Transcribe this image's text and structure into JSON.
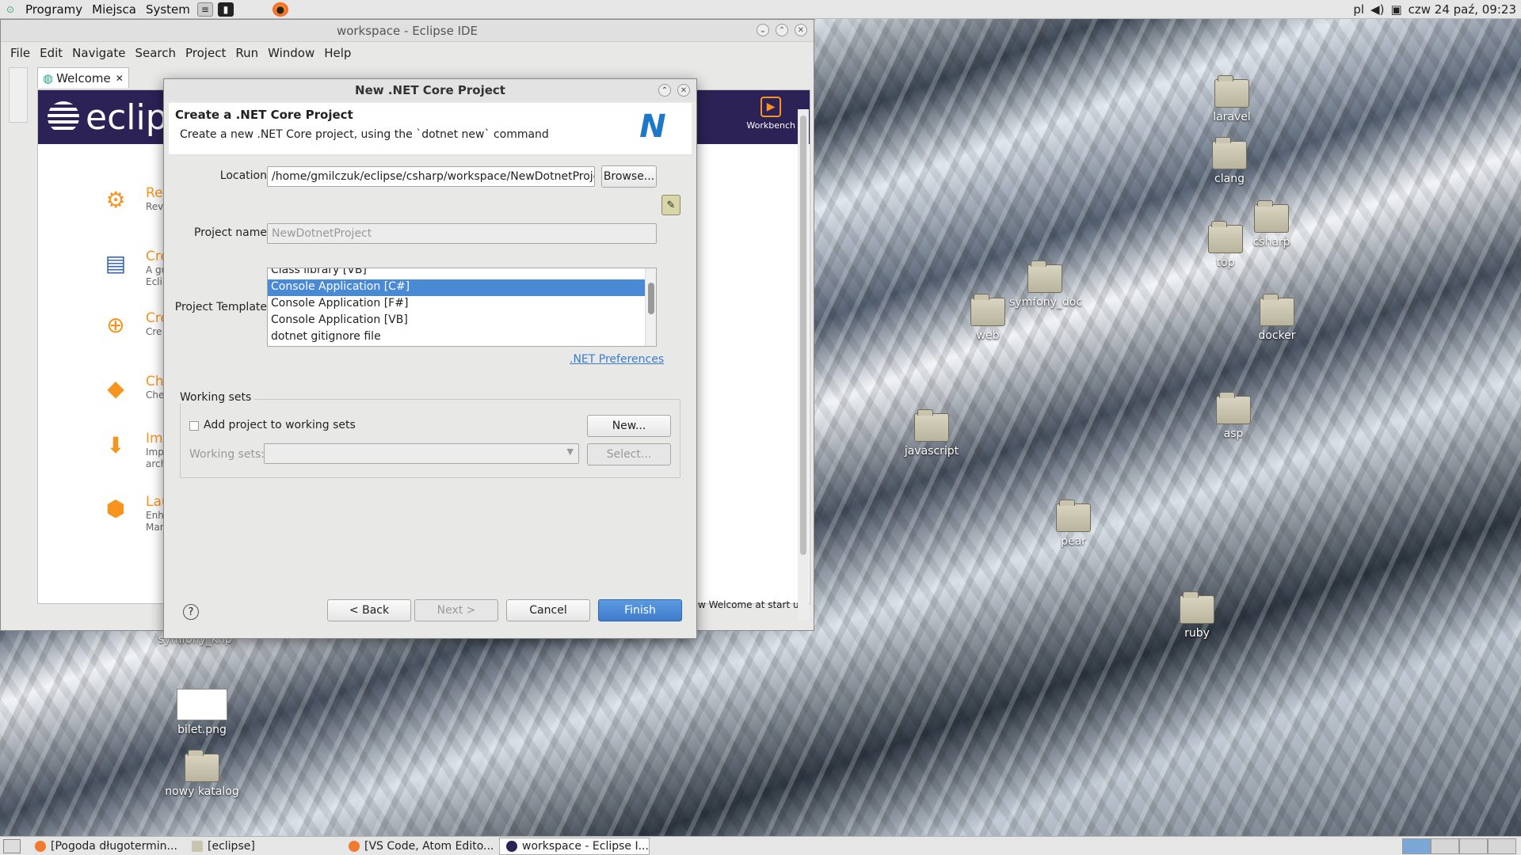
{
  "top_panel": {
    "menus": [
      "Programy",
      "Miejsca",
      "System"
    ],
    "tray_lang": "pl",
    "clock": "czw 24 paź, 09:23"
  },
  "desktop_icons": [
    "laravel",
    "clang",
    "csharp",
    "top",
    "symfony_doc",
    "web",
    "docker",
    "asp",
    "javascript",
    "pear",
    "ruby",
    "symfony_knp",
    "bilet.png",
    "nowy katalog"
  ],
  "eclipse": {
    "title": "workspace - Eclipse IDE",
    "menu": [
      "File",
      "Edit",
      "Navigate",
      "Search",
      "Project",
      "Run",
      "Window",
      "Help"
    ],
    "tab": "Welcome",
    "logo": "eclips",
    "workbench": "Workbench",
    "items": [
      {
        "h": "Re",
        "d": "Rev"
      },
      {
        "h": "Cre",
        "d": "A gu\nEcli"
      },
      {
        "h": "Cre",
        "d": "Cre"
      },
      {
        "h": "Ch",
        "d": "Che"
      },
      {
        "h": "Imp",
        "d": "Imp\narch"
      },
      {
        "h": "Lau",
        "d": "Enh\nMar"
      }
    ],
    "show_welcome": "w Welcome at start up"
  },
  "dialog": {
    "title": "New .NET Core Project",
    "header_title": "Create a .NET Core Project",
    "header_sub": "Create a new .NET Core project, using the `dotnet new` command",
    "location_label": "Location",
    "location_value": "/home/gmilczuk/eclipse/csharp/workspace/NewDotnetProject",
    "browse": "Browse...",
    "project_name_label": "Project name",
    "project_name_value": "NewDotnetProject",
    "template_label": "Project Template",
    "templates": [
      "Class library [VB]",
      "Console Application [C#]",
      "Console Application [F#]",
      "Console Application [VB]",
      "dotnet gitignore file"
    ],
    "selected_template": 1,
    "net_prefs": ".NET Preferences",
    "working_sets_title": "Working sets",
    "add_to_ws": "Add project to working sets",
    "add_to_ws_checked": false,
    "new_btn": "New...",
    "ws_label": "Working sets:",
    "select_btn": "Select...",
    "back": "< Back",
    "next": "Next >",
    "cancel": "Cancel",
    "finish": "Finish"
  },
  "taskbar": [
    "[Pogoda długotermin...",
    "[eclipse]",
    "[VS Code, Atom Edito...",
    "workspace - Eclipse I..."
  ],
  "colors": {
    "accent": "#4a89d4",
    "eclipse_banner": "#2c2255",
    "eclipse_orange": "#f7941e"
  }
}
